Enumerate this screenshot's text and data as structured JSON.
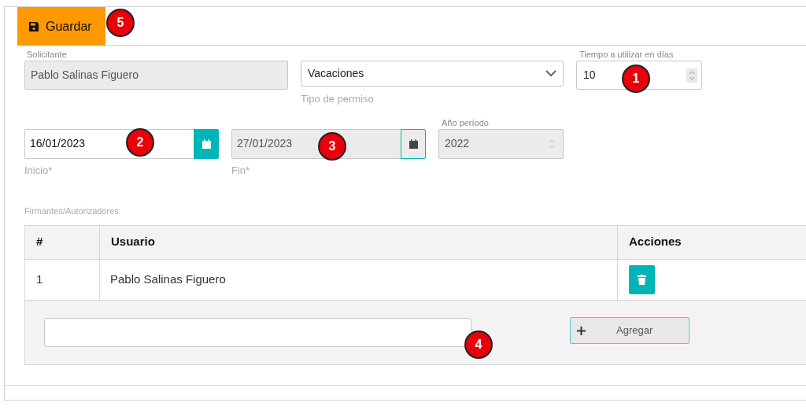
{
  "toolbar": {
    "save_button": "Guardar"
  },
  "form": {
    "solicitante": {
      "label": "Solicitante",
      "value": "Pablo Salinas Figuero",
      "disabled": true
    },
    "tipo": {
      "value": "Vacaciones",
      "hint": "Tipo de permiso"
    },
    "tiempo": {
      "label": "Tiempo a utilizar en días",
      "value": "10"
    },
    "inicio": {
      "value": "16/01/2023",
      "hint": "Inicio*",
      "disabled": false
    },
    "fin": {
      "value": "27/01/2023",
      "hint": "Fin*",
      "disabled": true
    },
    "anio": {
      "label": "Año período",
      "value": "2022",
      "disabled": true
    }
  },
  "signers": {
    "title": "Firmantes/Autorizadores",
    "columns": [
      "#",
      "Usuario",
      "Acciones"
    ],
    "rows": [
      {
        "number": "1",
        "user": "Pablo Salinas Figuero"
      }
    ],
    "add_button": "Agregar"
  },
  "markers": [
    {
      "label": "5"
    },
    {
      "label": "1"
    },
    {
      "label": "2"
    },
    {
      "label": "3"
    },
    {
      "label": "4"
    }
  ]
}
